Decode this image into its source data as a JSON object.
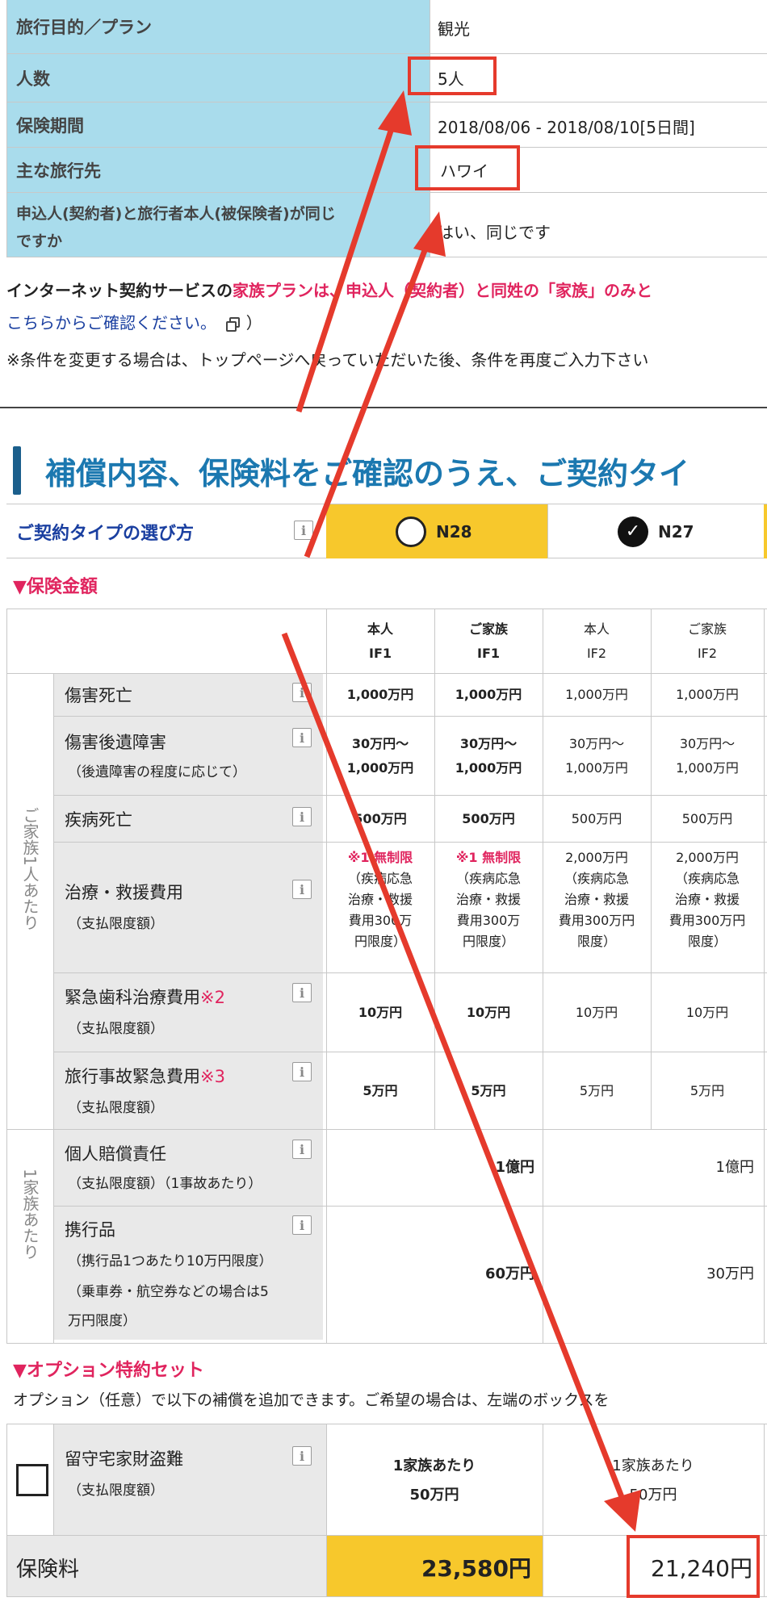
{
  "summary": {
    "rows": [
      {
        "label": "旅行目的／プラン",
        "value": "観光"
      },
      {
        "label": "人数",
        "value": "5人"
      },
      {
        "label": "保険期間",
        "value": "2018/08/06 - 2018/08/10[5日間]"
      },
      {
        "label": "主な旅行先",
        "value": "ハワイ"
      },
      {
        "label_l1": "申込人(契約者)と旅行者本人(被保険者)が同じ",
        "label_l2": "ですか",
        "value": "はい、同じです"
      }
    ]
  },
  "notice": {
    "line1_black": "インターネット契約サービスの",
    "line1_pink": "家族プランは、申込人（契約者）と同姓の「家族」のみと",
    "link": "こちらからご確認ください。",
    "link_suffix": "）",
    "line3": "※条件を変更する場合は、トップページへ戻っていただいた後、条件を再度ご入力下さい"
  },
  "section_title": "補償内容、保険料をご確認のうえ、ご契約タイ",
  "contract_type": {
    "label": "ご契約タイプの選び方",
    "options": [
      "N28",
      "N27"
    ]
  },
  "coverage": {
    "header": "▼保険金額",
    "col_headers": [
      {
        "l1": "本人",
        "l2": "IF1"
      },
      {
        "l1": "ご家族",
        "l2": "IF1"
      },
      {
        "l1": "本人",
        "l2": "IF2"
      },
      {
        "l1": "ご家族",
        "l2": "IF2"
      }
    ],
    "group_per_person": "ご家族1人あたり",
    "group_per_family": "1家族あたり",
    "rows": [
      {
        "name": "傷害死亡",
        "vals": [
          "1,000万円",
          "1,000万円",
          "1,000万円",
          "1,000万円"
        ]
      },
      {
        "name": "傷害後遺障害",
        "sub": "（後遺障害の程度に応じて）",
        "vals": [
          "30万円〜\n1,000万円",
          "30万円〜\n1,000万円",
          "30万円〜\n1,000万円",
          "30万円〜\n1,000万円"
        ]
      },
      {
        "name": "疾病死亡",
        "vals": [
          "500万円",
          "500万円",
          "500万円",
          "500万円"
        ]
      },
      {
        "name": "治療・救援費用",
        "sub": "（支払限度額）",
        "vals": [
          "※1 無制限",
          "※1 無制限",
          "2,000万円",
          "2,000万円"
        ],
        "subvals": [
          "（疾病応急\n治療・救援\n費用300万\n円限度）",
          "（疾病応急\n治療・救援\n費用300万\n円限度）",
          "（疾病応急\n治療・救援\n費用300万円\n限度）",
          "（疾病応急\n治療・救援\n費用300万円\n限度）"
        ]
      },
      {
        "name": "緊急歯科治療費用",
        "note": "※2",
        "sub": "（支払限度額）",
        "vals": [
          "10万円",
          "10万円",
          "10万円",
          "10万円"
        ]
      },
      {
        "name": "旅行事故緊急費用",
        "note": "※3",
        "sub": "（支払限度額）",
        "vals": [
          "5万円",
          "5万円",
          "5万円",
          "5万円"
        ]
      },
      {
        "name": "個人賠償責任",
        "sub": "（支払限度額）（1事故あたり）",
        "vals": [
          "1億円",
          "1億円"
        ]
      },
      {
        "name": "携行品",
        "sub": "（携行品1つあたり10万円限度）",
        "sub2": "（乗車券・航空券などの場合は5",
        "sub3": "万円限度）",
        "vals": [
          "60万円",
          "30万円"
        ]
      }
    ]
  },
  "option": {
    "header": "▼オプション特約セット",
    "desc": "オプション（任意）で以下の補償を追加できます。ご希望の場合は、左端のボックスを",
    "item_name": "留守宅家財盗難",
    "item_sub": "（支払限度額）",
    "vals": [
      {
        "l1": "1家族あたり",
        "l2": "50万円"
      },
      {
        "l1": "1家族あたり",
        "l2": "50万円"
      }
    ]
  },
  "premium": {
    "label": "保険料",
    "n28": "23,580円",
    "n27": "21,240円"
  },
  "colors": {
    "label_bg": "#a9dcec",
    "accent_yellow": "#f7c82c",
    "title_blue": "#1b78b0",
    "pink": "#e0245e",
    "annotation_red": "#e53a2c"
  }
}
